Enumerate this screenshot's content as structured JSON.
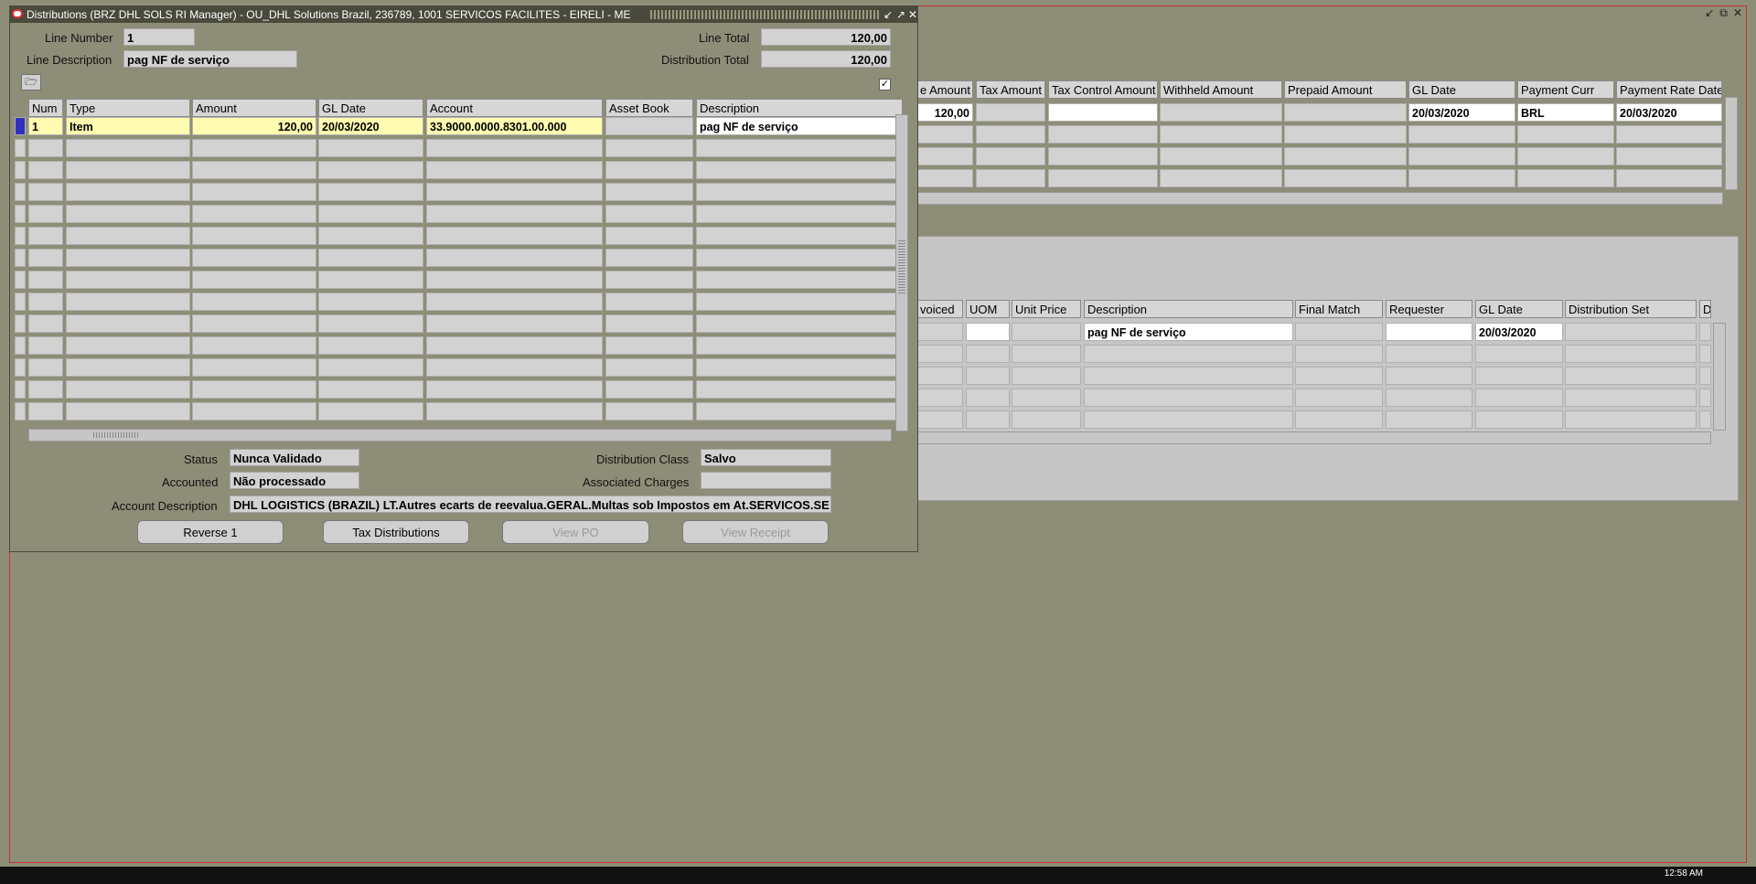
{
  "dialog": {
    "title": "Distributions (BRZ DHL SOLS RI Manager) - OU_DHL Solutions Brazil, 236789, 1001 SERVICOS FACILITES - EIRELI - ME",
    "line_number_label": "Line Number",
    "line_number": "1",
    "line_description_label": "Line Description",
    "line_description": "pag NF de serviço",
    "line_total_label": "Line Total",
    "line_total": "120,00",
    "distribution_total_label": "Distribution Total",
    "distribution_total": "120,00",
    "columns": [
      "Num",
      "Type",
      "Amount",
      "GL Date",
      "Account",
      "Asset Book",
      "Description"
    ],
    "rows": [
      {
        "num": "1",
        "type": "Item",
        "amount": "120,00",
        "gl_date": "20/03/2020",
        "account": "33.9000.0000.8301.00.000",
        "asset_book": "",
        "description": "pag NF de serviço"
      }
    ],
    "status_label": "Status",
    "status": "Nunca Validado",
    "accounted_label": "Accounted",
    "accounted": "Não processado",
    "account_description_label": "Account Description",
    "account_description": "DHL LOGISTICS (BRAZIL) LT.Autres ecarts de reevalua.GERAL.Multas sob Impostos em At.SERVICOS.SE",
    "distribution_class_label": "Distribution Class",
    "distribution_class": "Salvo",
    "associated_charges_label": "Associated Charges",
    "associated_charges": "",
    "buttons": {
      "reverse": "Reverse 1",
      "tax_distributions": "Tax Distributions",
      "view_po": "View PO",
      "view_receipt": "View Receipt"
    }
  },
  "background": {
    "top_columns": [
      "e Amount",
      "Tax Amount",
      "Tax Control Amount",
      "Withheld Amount",
      "Prepaid Amount",
      "GL Date",
      "Payment Curr",
      "Payment Rate Date"
    ],
    "top_row": [
      "120,00",
      "",
      "",
      "",
      "",
      "20/03/2020",
      "BRL",
      "20/03/2020"
    ],
    "bottom_columns": [
      "voiced",
      "UOM",
      "Unit Price",
      "Description",
      "Final Match",
      "Requester",
      "GL Date",
      "Distribution Set",
      "De"
    ],
    "bottom_row": [
      "",
      "",
      "",
      "pag NF de serviço",
      "",
      "",
      "20/03/2020",
      "",
      ""
    ]
  },
  "taskbar": {
    "time": "12:58 AM"
  },
  "colors": {
    "desktop": "#8e8d78",
    "current_row": "#fffbb0",
    "title_bar": "#4a4a3c",
    "window_border": "#c83232"
  }
}
